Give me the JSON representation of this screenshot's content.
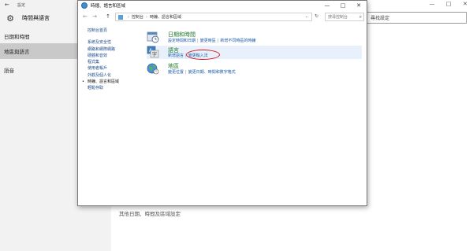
{
  "settings": {
    "app_label": "設定",
    "back_glyph": "←",
    "min_glyph": "—",
    "max_glyph": "□",
    "close_glyph": "✕",
    "header_title": "時間與語言",
    "nav": [
      "日期和時間",
      "地區與語言",
      "語音"
    ],
    "search_placeholder": "尋找設定",
    "bottom_link": "其他日期、時間及區域設定"
  },
  "control_panel": {
    "title": "時鐘、語言和區域",
    "min_glyph": "—",
    "max_glyph": "□",
    "close_glyph": "✕",
    "nav": {
      "back": "←",
      "forward": "→",
      "up": "↑"
    },
    "breadcrumb": [
      "控制台",
      "時鐘、語言和區域"
    ],
    "refresh_glyph": "↻",
    "search_placeholder": "搜尋控制台",
    "left_nav": {
      "home": "控制台首頁",
      "items": [
        "系統及安全性",
        "網路和網際網路",
        "硬體和音效",
        "程式集",
        "使用者帳戶",
        "外觀及個人化",
        "時鐘、語言和區域",
        "輕鬆存取"
      ],
      "current_index": 6
    },
    "categories": [
      {
        "title": "日期和時間",
        "links": [
          "設定時間和日期",
          "變更時區",
          "新增不同時區的時鐘"
        ]
      },
      {
        "title": "語言",
        "links": [
          "新增語言",
          "變更輸入法"
        ]
      },
      {
        "title": "地區",
        "links": [
          "變更位置",
          "變更日期、時間和數字格式"
        ]
      }
    ]
  },
  "colors": {
    "highlight_circle": "#d51a1a",
    "category_title": "#1e7a2a",
    "link": "#1a5aa8"
  }
}
